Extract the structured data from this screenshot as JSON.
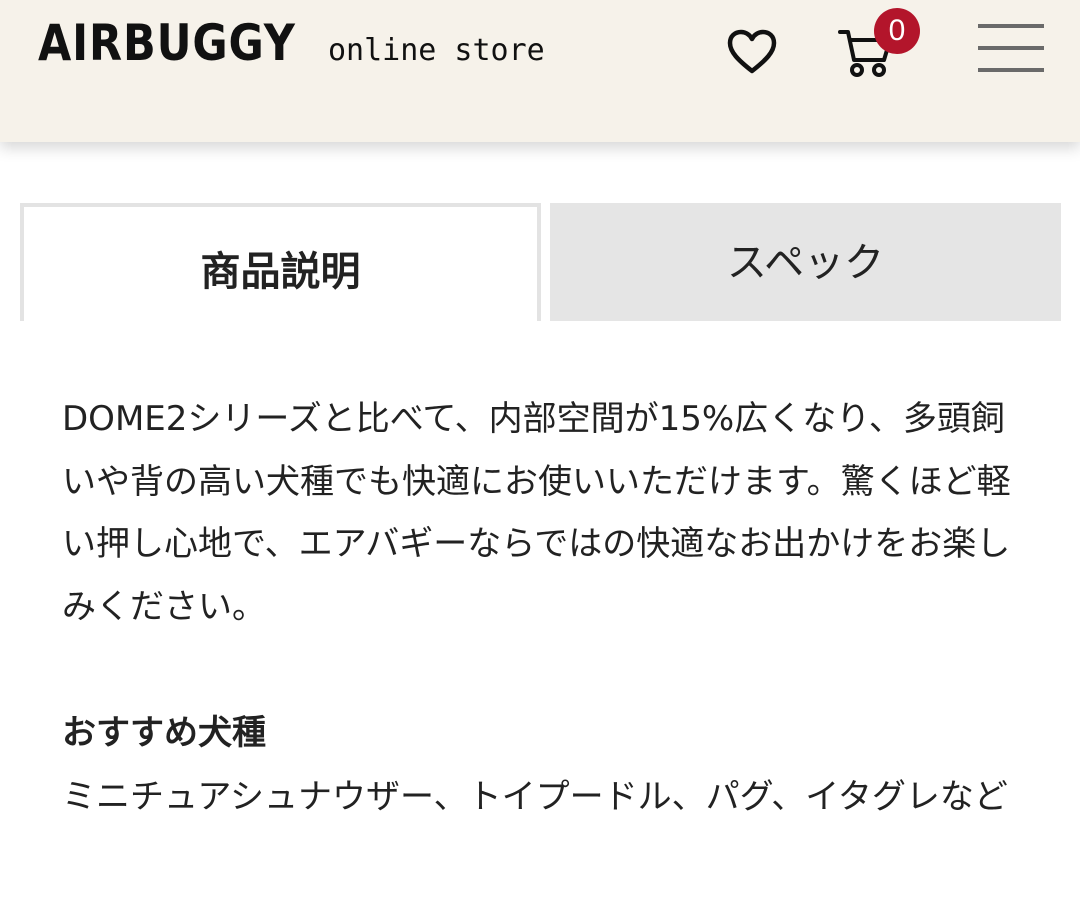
{
  "header": {
    "logo_main": "AIRBUGGY",
    "logo_sub": "online store",
    "favorite_icon": "heart-icon",
    "cart_icon": "cart-icon",
    "cart_count": "0",
    "menu_icon": "hamburger-menu-icon",
    "colors": {
      "background": "#f6f2ea",
      "badge": "#b3152b"
    }
  },
  "tabs": [
    {
      "label": "商品説明",
      "active": true
    },
    {
      "label": "スペック",
      "active": false
    }
  ],
  "description": {
    "paragraph": "DOME2シリーズと比べて、内部空間が15%広くなり、多頭飼いや背の高い犬種でも快適にお使いいただけます。驚くほど軽い押し心地で、エアバギーならではの快適なお出かけをお楽しみください。"
  },
  "recommended": {
    "heading": "おすすめ犬種",
    "breeds": "ミニチュアシュナウザー、トイプードル、パグ、イタグレなど"
  }
}
